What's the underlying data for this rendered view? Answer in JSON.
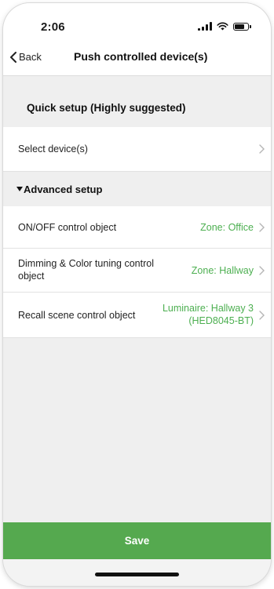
{
  "status_bar": {
    "time": "2:06",
    "battery_level": 0.8
  },
  "nav": {
    "back_label": "Back",
    "title": "Push controlled device(s)"
  },
  "quick_setup": {
    "label": "Quick setup (Highly suggested)"
  },
  "select_devices": {
    "label": "Select device(s)"
  },
  "advanced_setup": {
    "label": "Advanced setup"
  },
  "rows": [
    {
      "label": "ON/OFF control object",
      "value": "Zone: Office"
    },
    {
      "label": "Dimming & Color tuning control object",
      "value": "Zone: Hallway"
    },
    {
      "label": "Recall scene control object",
      "value": "Luminaire: Hallway 3 (HED8045-BT)"
    }
  ],
  "save": {
    "label": "Save"
  },
  "colors": {
    "accent": "#4caf50",
    "save_bar": "#55a94f",
    "background": "#efefef"
  }
}
